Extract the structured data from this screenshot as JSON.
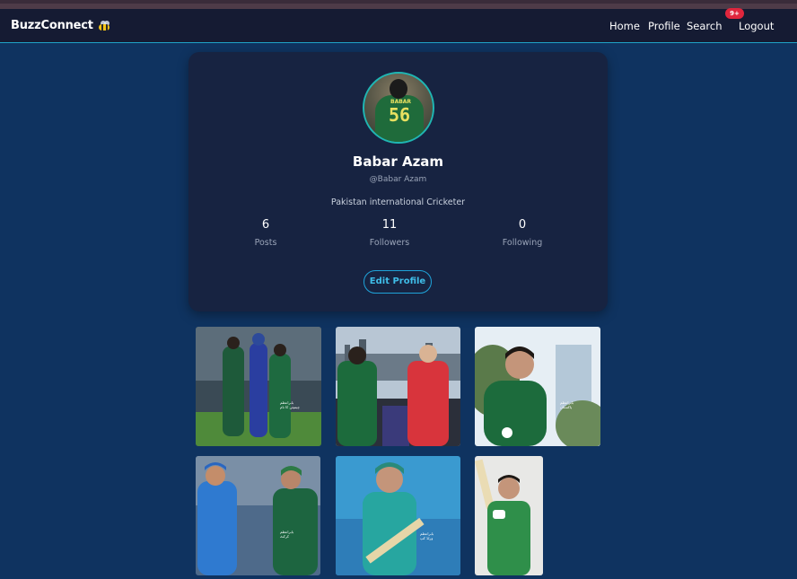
{
  "navbar": {
    "brand": "BuzzConnect",
    "links": {
      "home": "Home",
      "profile": "Profile",
      "search": "Search",
      "logout": "Logout"
    },
    "notification_badge": "9+"
  },
  "profile": {
    "name": "Babar Azam",
    "username": "@Babar Azam",
    "bio": "Pakistan international Cricketer",
    "avatar_jersey_name": "BABAR",
    "avatar_jersey_number": "56",
    "stats": [
      {
        "value": "6",
        "label": "Posts"
      },
      {
        "value": "11",
        "label": "Followers"
      },
      {
        "value": "0",
        "label": "Following"
      }
    ],
    "edit_button": "Edit Profile"
  },
  "posts": [
    {
      "watermark": "بابراعظم\nچیمپئن کا نام"
    },
    {
      "watermark": ""
    },
    {
      "watermark": "بابراعظم\nپاکستان"
    },
    {
      "watermark": "بابراعظم\nکرکٹ"
    },
    {
      "watermark": "بابراعظم\nورلڈ کپ"
    },
    {
      "watermark": ""
    }
  ],
  "colors": {
    "background": "#0f3360",
    "navbar": "#151b33",
    "card": "#172341",
    "accent": "#1fa3d9",
    "badge": "#e0263d"
  }
}
